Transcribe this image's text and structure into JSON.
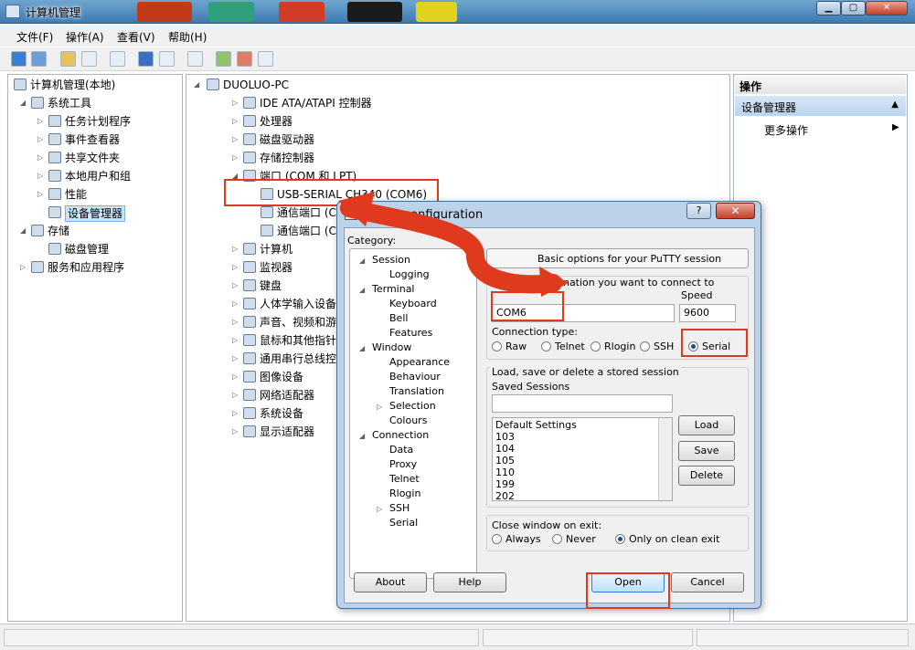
{
  "window": {
    "title": "计算机管理"
  },
  "menubar": [
    "文件(F)",
    "操作(A)",
    "查看(V)",
    "帮助(H)"
  ],
  "left_tree": [
    {
      "label": "计算机管理(本地)",
      "level": 0,
      "expander": ""
    },
    {
      "label": "系统工具",
      "level": 1,
      "expander": "open"
    },
    {
      "label": "任务计划程序",
      "level": 2,
      "expander": "closed"
    },
    {
      "label": "事件查看器",
      "level": 2,
      "expander": "closed"
    },
    {
      "label": "共享文件夹",
      "level": 2,
      "expander": "closed"
    },
    {
      "label": "本地用户和组",
      "level": 2,
      "expander": "closed"
    },
    {
      "label": "性能",
      "level": 2,
      "expander": "closed"
    },
    {
      "label": "设备管理器",
      "level": 2,
      "expander": "",
      "selected": true
    },
    {
      "label": "存储",
      "level": 1,
      "expander": "open"
    },
    {
      "label": "磁盘管理",
      "level": 2,
      "expander": ""
    },
    {
      "label": "服务和应用程序",
      "level": 1,
      "expander": "closed"
    }
  ],
  "device_tree": {
    "root": "DUOLUO-PC",
    "items": [
      {
        "label": "IDE ATA/ATAPI 控制器",
        "level": 1,
        "expander": "closed"
      },
      {
        "label": "处理器",
        "level": 1,
        "expander": "closed"
      },
      {
        "label": "磁盘驱动器",
        "level": 1,
        "expander": "closed"
      },
      {
        "label": "存储控制器",
        "level": 1,
        "expander": "closed"
      },
      {
        "label": "端口 (COM 和 LPT)",
        "level": 1,
        "expander": "open"
      },
      {
        "label": "USB-SERIAL CH340 (COM6)",
        "level": 2,
        "expander": ""
      },
      {
        "label": "通信端口 (COM",
        "level": 2,
        "expander": ""
      },
      {
        "label": "通信端口 (COM",
        "level": 2,
        "expander": ""
      },
      {
        "label": "计算机",
        "level": 1,
        "expander": "closed"
      },
      {
        "label": "监视器",
        "level": 1,
        "expander": "closed"
      },
      {
        "label": "键盘",
        "level": 1,
        "expander": "closed"
      },
      {
        "label": "人体学输入设备",
        "level": 1,
        "expander": "closed"
      },
      {
        "label": "声音、视频和游戏控",
        "level": 1,
        "expander": "closed"
      },
      {
        "label": "鼠标和其他指针设备",
        "level": 1,
        "expander": "closed"
      },
      {
        "label": "通用串行总线控制器",
        "level": 1,
        "expander": "closed"
      },
      {
        "label": "图像设备",
        "level": 1,
        "expander": "closed"
      },
      {
        "label": "网络适配器",
        "level": 1,
        "expander": "closed"
      },
      {
        "label": "系统设备",
        "level": 1,
        "expander": "closed"
      },
      {
        "label": "显示适配器",
        "level": 1,
        "expander": "closed"
      }
    ]
  },
  "actions": {
    "header": "操作",
    "selected": "设备管理器",
    "more": "更多操作"
  },
  "putty": {
    "title": "configuration",
    "help_button": "?",
    "category_label": "Category:",
    "categories": [
      {
        "label": "Session",
        "level": 0,
        "expander": "open"
      },
      {
        "label": "Logging",
        "level": 1,
        "expander": ""
      },
      {
        "label": "Terminal",
        "level": 0,
        "expander": "open"
      },
      {
        "label": "Keyboard",
        "level": 1,
        "expander": ""
      },
      {
        "label": "Bell",
        "level": 1,
        "expander": ""
      },
      {
        "label": "Features",
        "level": 1,
        "expander": ""
      },
      {
        "label": "Window",
        "level": 0,
        "expander": "open"
      },
      {
        "label": "Appearance",
        "level": 1,
        "expander": ""
      },
      {
        "label": "Behaviour",
        "level": 1,
        "expander": ""
      },
      {
        "label": "Translation",
        "level": 1,
        "expander": ""
      },
      {
        "label": "Selection",
        "level": 1,
        "expander": "closed"
      },
      {
        "label": "Colours",
        "level": 1,
        "expander": ""
      },
      {
        "label": "Connection",
        "level": 0,
        "expander": "open"
      },
      {
        "label": "Data",
        "level": 1,
        "expander": ""
      },
      {
        "label": "Proxy",
        "level": 1,
        "expander": ""
      },
      {
        "label": "Telnet",
        "level": 1,
        "expander": ""
      },
      {
        "label": "Rlogin",
        "level": 1,
        "expander": ""
      },
      {
        "label": "SSH",
        "level": 1,
        "expander": "closed"
      },
      {
        "label": "Serial",
        "level": 1,
        "expander": ""
      }
    ],
    "basic_options": "Basic options for your PuTTY session",
    "destination_label": "ecify the estination you want to connect to",
    "serial_line_value": "COM6",
    "speed_label": "Speed",
    "speed_value": "9600",
    "connection_type_label": "Connection type:",
    "connection_types": [
      {
        "label": "Raw",
        "checked": false
      },
      {
        "label": "Telnet",
        "checked": false
      },
      {
        "label": "Rlogin",
        "checked": false
      },
      {
        "label": "SSH",
        "checked": false
      },
      {
        "label": "Serial",
        "checked": true
      }
    ],
    "sessions_group_label": "Load, save or delete a stored session",
    "saved_sessions_label": "Saved Sessions",
    "saved_sessions_value": "",
    "sessions": [
      "Default Settings",
      "103",
      "104",
      "105",
      "110",
      "199",
      "202"
    ],
    "load_button": "Load",
    "save_button": "Save",
    "delete_button": "Delete",
    "close_on_exit_label": "Close window on exit:",
    "close_options": [
      {
        "label": "Always",
        "checked": false
      },
      {
        "label": "Never",
        "checked": false
      },
      {
        "label": "Only on clean exit",
        "checked": true
      }
    ],
    "about_button": "About",
    "help_bottom_button": "Help",
    "open_button": "Open",
    "cancel_button": "Cancel"
  },
  "colors": {
    "annotation": "#e03a1e",
    "selection": "#cce4f7"
  }
}
